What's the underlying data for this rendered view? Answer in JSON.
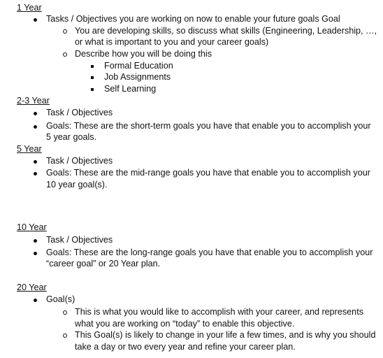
{
  "sections": [
    {
      "heading": "1 Year",
      "items": [
        {
          "text": "Tasks / Objectives you are working on now to enable your future goals Goal",
          "subitems": [
            {
              "lines": [
                "You are developing skills, so discuss what skills (Engineering, Leadership, …,",
                "or what is important to you and your career goals)"
              ]
            },
            {
              "lines": [
                "Describe how you will be doing this"
              ],
              "subitems": [
                "Formal Education",
                "Job Assignments",
                "Self Learning"
              ]
            }
          ]
        }
      ]
    },
    {
      "heading": "2-3 Year",
      "items": [
        {
          "lines": [
            "Task / Objectives"
          ]
        },
        {
          "lines": [
            "Goals:  These are the short-term goals you have that enable you to accomplish your",
            "5 year goals."
          ]
        }
      ]
    },
    {
      "heading": "5 Year",
      "items": [
        {
          "lines": [
            "Task / Objectives"
          ]
        },
        {
          "lines": [
            "Goals:  These are the mid-range goals you have that enable you to accomplish your",
            "10 year goal(s)."
          ]
        }
      ]
    },
    {
      "heading": "10 Year",
      "items": [
        {
          "lines": [
            "Task / Objectives"
          ]
        },
        {
          "lines": [
            "Goals:  These are the long-range goals you have that enable you to accomplish your",
            "“career goal” or 20 Year plan."
          ]
        }
      ]
    },
    {
      "heading": "20 Year",
      "items": [
        {
          "text": "Goal(s)",
          "subitems": [
            {
              "lines": [
                "This is what you would like to accomplish with your career, and represents",
                "what you are working on “today” to enable this objective."
              ]
            },
            {
              "lines": [
                "This Goal(s) is likely to change in your life a few times, and is why you should",
                "take a day or two every year and refine your career plan."
              ]
            }
          ]
        }
      ]
    }
  ]
}
